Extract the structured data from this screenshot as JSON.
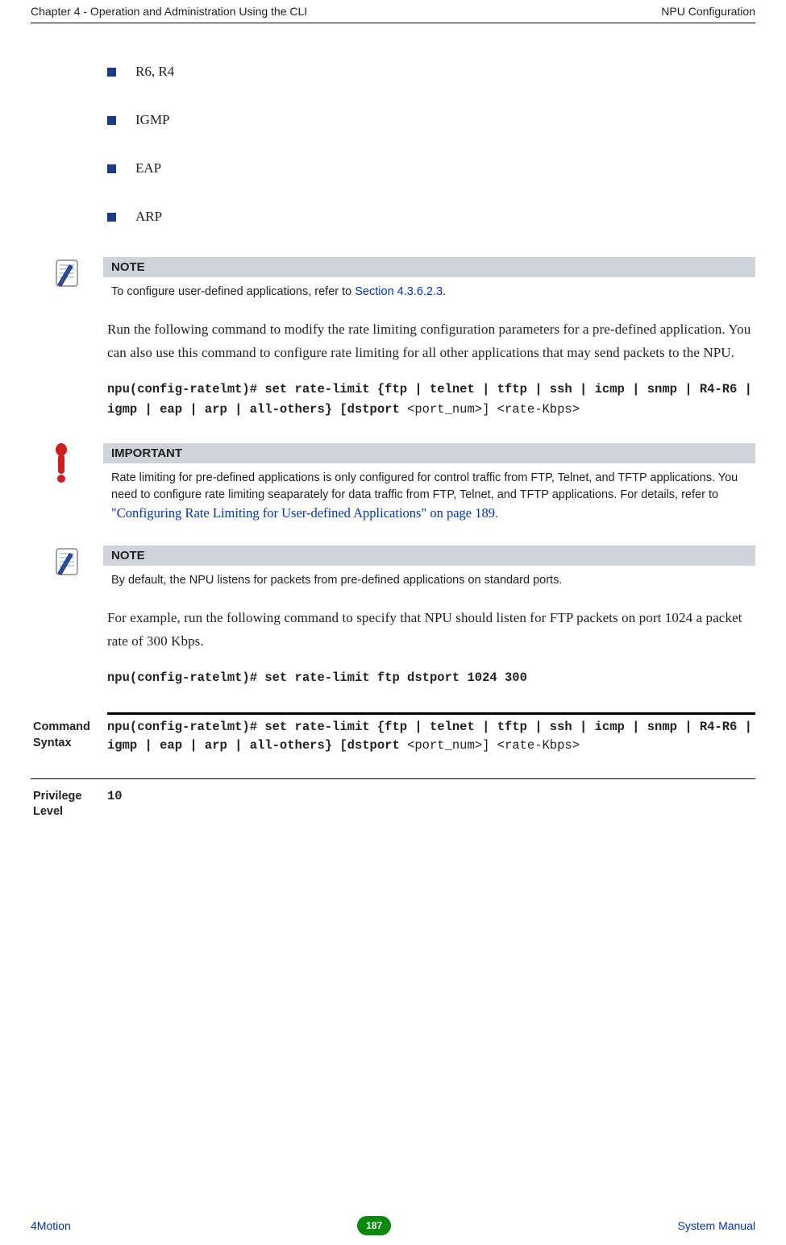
{
  "header": {
    "left": "Chapter 4 - Operation and Administration Using the CLI",
    "right": "NPU Configuration"
  },
  "content": {
    "bullets": [
      "R6, R4",
      "IGMP",
      "EAP",
      "ARP"
    ],
    "note1": {
      "label": "NOTE",
      "textBefore": "To configure user-defined applications, refer to  ",
      "link": "Section 4.3.6.2.3",
      "textAfter": "."
    },
    "para1": "Run the following command to modify the rate limiting configuration parameters for a pre-defined application. You can also use this command to configure rate limiting for all other applications that may send packets to the NPU.",
    "cmd1": {
      "prefix": "npu(config-ratelmt)# set rate-limit",
      "opts": " {ftp | telnet | tftp | ssh | icmp | snmp | R4-R6 | igmp | eap | arp | all-others} [dstport",
      "suffix": " <port_num>] <rate-Kbps>"
    },
    "important": {
      "label": "IMPORTANT",
      "textBefore": "Rate limiting for pre-defined applications is only configured for control traffic from FTP, Telnet, and TFTP applications. You need to configure rate limiting seaparately for data traffic from  FTP, Telnet, and TFTP applications. For details, refer to ",
      "link": "\"Configuring Rate Limiting for User-defined Applications\" on page 189",
      "textAfter": "."
    },
    "note2": {
      "label": "NOTE",
      "text": "By default, the NPU  listens for packets from pre-defined applications on standard ports."
    },
    "para2": "For example, run the following command to specify that NPU should listen for FTP packets on port 1024 a packet rate of 300 Kbps.",
    "cmd2": "npu(config-ratelmt)# set rate-limit ftp dstport 1024 300",
    "syntax": {
      "label": "Command Syntax",
      "prefix": "npu(config-ratelmt)# set rate-limit",
      "opts": " {ftp | telnet | tftp | ssh | icmp | snmp | R4-R6 | igmp | eap | arp | all-others} [dstport ",
      "suffix": "<port_num>] <rate-Kbps>"
    },
    "privilege": {
      "label": "Privilege Level",
      "value": "10"
    }
  },
  "footer": {
    "left": "4Motion",
    "page": "187",
    "right": " System Manual"
  }
}
